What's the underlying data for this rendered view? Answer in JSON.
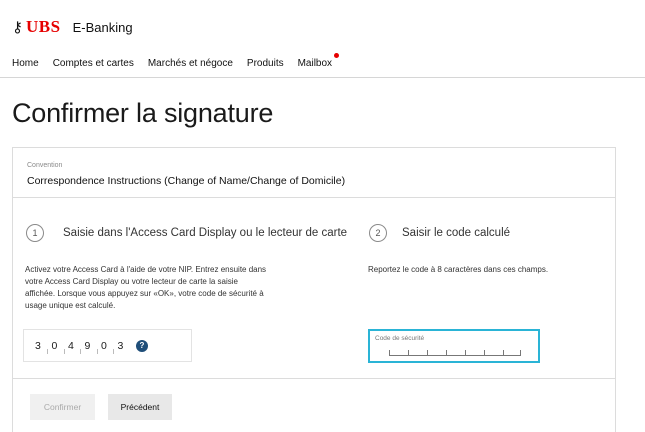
{
  "header": {
    "logo_keys": "⚷",
    "logo_text": "UBS",
    "app_name": "E-Banking"
  },
  "nav": {
    "items": [
      "Home",
      "Comptes et cartes",
      "Marchés et négoce",
      "Produits",
      "Mailbox"
    ]
  },
  "page_title": "Confirmer la signature",
  "convention": {
    "label": "Convention",
    "value": "Correspondence Instructions (Change of Name/Change of Domicile)"
  },
  "step1": {
    "number": "1",
    "title": "Saisie dans l'Access Card Display ou le lecteur de carte",
    "desc_lines": [
      "Activez votre Access Card à l'aide de votre NIP. Entrez ensuite dans",
      "votre Access Card Display ou votre lecteur de carte la saisie",
      "affichée. Lorsque vous appuyez sur «OK», votre code de sécurité à",
      "usage unique est calculé."
    ],
    "code_digits": [
      "3",
      "0",
      "4",
      "9",
      "0",
      "3"
    ],
    "help_icon": "question-circle-icon"
  },
  "step2": {
    "number": "2",
    "title": "Saisir le code calculé",
    "desc": "Reportez le code à 8 caractères dans ces champs.",
    "field_label": "Code de sécurité",
    "field_value": ""
  },
  "buttons": {
    "confirm": "Confirmer",
    "previous": "Précédent"
  },
  "colors": {
    "brand_red": "#e60000",
    "focus_blue": "#2ab4d6",
    "help_icon_blue": "#1f4e79"
  }
}
